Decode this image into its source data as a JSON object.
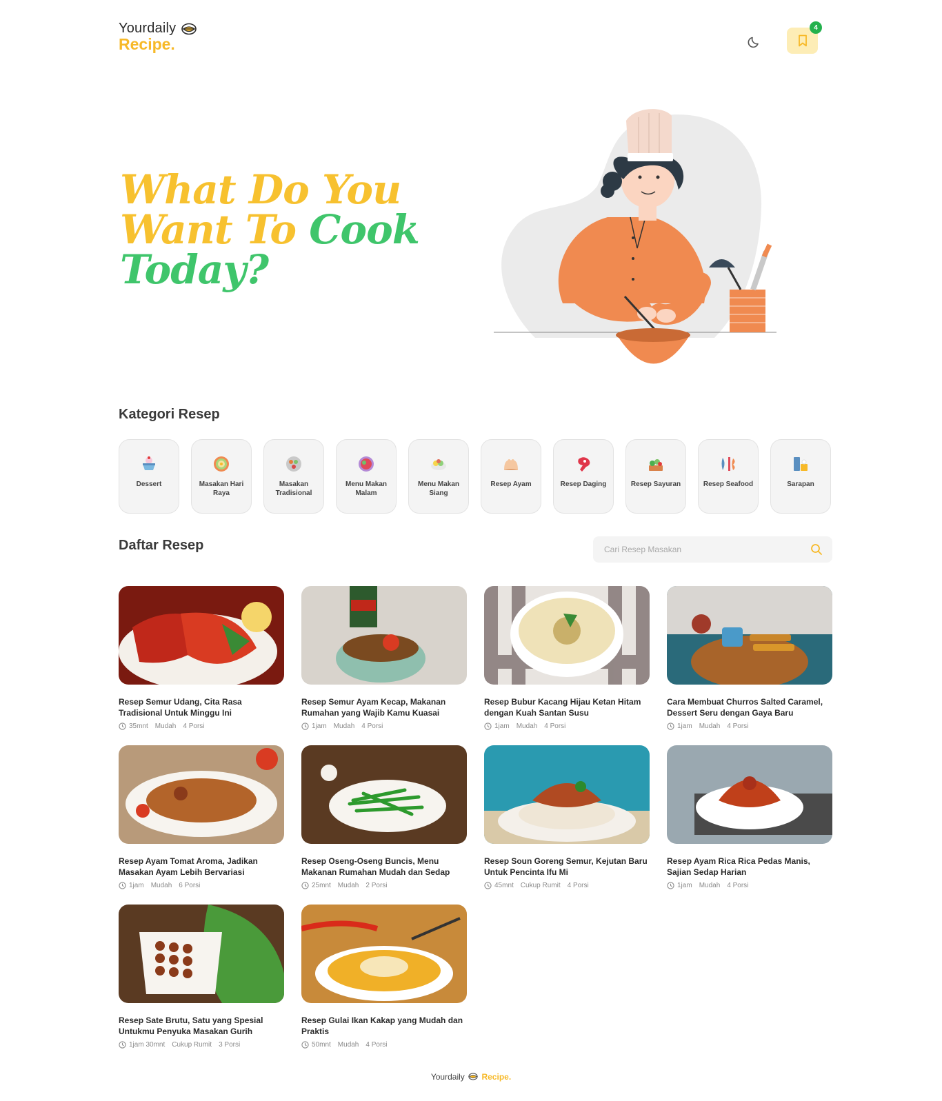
{
  "header": {
    "logo_top": "Yourdaily",
    "logo_bottom": "Recipe.",
    "bookmark_count": "4"
  },
  "hero": {
    "line1": "What Do You",
    "line2a": "Want To ",
    "line2b": "Cook",
    "line3": "Today?"
  },
  "categories_title": "Kategori Resep",
  "categories": [
    {
      "label": "Dessert",
      "icon": "dessert-icon"
    },
    {
      "label": "Masakan Hari Raya",
      "icon": "festive-dish-icon"
    },
    {
      "label": "Masakan Tradisional",
      "icon": "traditional-dish-icon"
    },
    {
      "label": "Menu Makan Malam",
      "icon": "dinner-icon"
    },
    {
      "label": "Menu Makan Siang",
      "icon": "lunch-icon"
    },
    {
      "label": "Resep Ayam",
      "icon": "chicken-icon"
    },
    {
      "label": "Resep Daging",
      "icon": "meat-icon"
    },
    {
      "label": "Resep Sayuran",
      "icon": "vegetable-icon"
    },
    {
      "label": "Resep Seafood",
      "icon": "seafood-icon"
    },
    {
      "label": "Sarapan",
      "icon": "breakfast-icon"
    }
  ],
  "recipes_title": "Daftar Resep",
  "search": {
    "placeholder": "Cari Resep Masakan"
  },
  "recipes": [
    {
      "title": "Resep Semur Udang, Cita Rasa Tradisional Untuk Minggu Ini",
      "time": "35mnt",
      "difficulty": "Mudah",
      "portion": "4 Porsi"
    },
    {
      "title": "Resep Semur Ayam Kecap, Makanan Rumahan yang Wajib Kamu Kuasai",
      "time": "1jam",
      "difficulty": "Mudah",
      "portion": "4 Porsi"
    },
    {
      "title": "Resep Bubur Kacang Hijau Ketan Hitam dengan Kuah Santan Susu",
      "time": "1jam",
      "difficulty": "Mudah",
      "portion": "4 Porsi"
    },
    {
      "title": "Cara Membuat Churros Salted Caramel, Dessert Seru dengan Gaya Baru",
      "time": "1jam",
      "difficulty": "Mudah",
      "portion": "4 Porsi"
    },
    {
      "title": "Resep Ayam Tomat Aroma, Jadikan Masakan Ayam Lebih Bervariasi",
      "time": "1jam",
      "difficulty": "Mudah",
      "portion": "6 Porsi"
    },
    {
      "title": "Resep Oseng-Oseng Buncis, Menu Makanan Rumahan Mudah dan Sedap",
      "time": "25mnt",
      "difficulty": "Mudah",
      "portion": "2 Porsi"
    },
    {
      "title": "Resep Soun Goreng Semur, Kejutan Baru Untuk Pencinta Ifu Mi",
      "time": "45mnt",
      "difficulty": "Cukup Rumit",
      "portion": "4 Porsi"
    },
    {
      "title": "Resep Ayam Rica Rica Pedas Manis, Sajian Sedap Harian",
      "time": "1jam",
      "difficulty": "Mudah",
      "portion": "4 Porsi"
    },
    {
      "title": "Resep Sate Brutu, Satu yang Spesial Untukmu Penyuka Masakan Gurih",
      "time": "1jam 30mnt",
      "difficulty": "Cukup Rumit",
      "portion": "3 Porsi"
    },
    {
      "title": "Resep Gulai Ikan Kakap yang Mudah dan Praktis",
      "time": "50mnt",
      "difficulty": "Mudah",
      "portion": "4 Porsi"
    }
  ],
  "footer": {
    "left": "Yourdaily",
    "right": "Recipe."
  },
  "colors": {
    "accent_yellow": "#f7b928",
    "accent_green": "#3fc56b",
    "badge_green": "#23b14d"
  }
}
